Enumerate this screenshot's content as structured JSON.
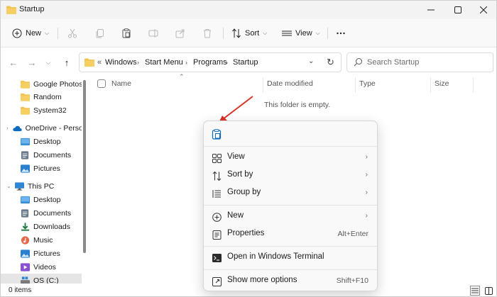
{
  "window": {
    "title": "Startup",
    "controls": {
      "minimize": "minimize",
      "maximize": "maximize",
      "close": "close"
    }
  },
  "toolbar": {
    "new_label": "New",
    "sort_label": "Sort",
    "view_label": "View",
    "icons": [
      "cut-icon",
      "copy-icon",
      "paste-icon",
      "rename-icon",
      "share-icon",
      "delete-icon",
      "more-icon"
    ]
  },
  "address": {
    "overflow": "«",
    "crumbs": [
      "Windows",
      "Start Menu",
      "Programs",
      "Startup"
    ]
  },
  "search": {
    "placeholder": "Search Startup"
  },
  "sidebar": {
    "items": [
      {
        "label": "Google Photos",
        "icon": "folder-icon"
      },
      {
        "label": "Random",
        "icon": "folder-icon"
      },
      {
        "label": "System32",
        "icon": "folder-icon"
      },
      {
        "label": "OneDrive - Person",
        "icon": "cloud-icon"
      },
      {
        "label": "Desktop",
        "icon": "desktop-icon"
      },
      {
        "label": "Documents",
        "icon": "documents-icon"
      },
      {
        "label": "Pictures",
        "icon": "pictures-icon"
      },
      {
        "label": "This PC",
        "icon": "pc-icon"
      },
      {
        "label": "Desktop",
        "icon": "desktop-icon"
      },
      {
        "label": "Documents",
        "icon": "documents-icon"
      },
      {
        "label": "Downloads",
        "icon": "downloads-icon"
      },
      {
        "label": "Music",
        "icon": "music-icon"
      },
      {
        "label": "Pictures",
        "icon": "pictures-icon"
      },
      {
        "label": "Videos",
        "icon": "videos-icon"
      },
      {
        "label": "OS (C:)",
        "icon": "drive-icon"
      }
    ]
  },
  "columns": {
    "name": "Name",
    "date": "Date modified",
    "type": "Type",
    "size": "Size"
  },
  "content": {
    "empty_message": "This folder is empty."
  },
  "status": {
    "items": "0 items"
  },
  "context_menu": {
    "top_icon": "paste-icon",
    "items": [
      {
        "label": "View",
        "icon": "view-grid-icon",
        "arrow": "›"
      },
      {
        "label": "Sort by",
        "icon": "sort-icon",
        "arrow": "›"
      },
      {
        "label": "Group by",
        "icon": "group-icon",
        "arrow": "›"
      },
      {
        "label": "New",
        "icon": "new-icon",
        "arrow": "›"
      },
      {
        "label": "Properties",
        "icon": "properties-icon",
        "shortcut": "Alt+Enter"
      },
      {
        "label": "Open in Windows Terminal",
        "icon": "terminal-icon"
      },
      {
        "label": "Show more options",
        "icon": "more-options-icon",
        "shortcut": "Shift+F10"
      }
    ]
  },
  "colors": {
    "folder": "#f2c14e",
    "accent": "#0067c0",
    "annotation_arrow": "#d9342b"
  }
}
